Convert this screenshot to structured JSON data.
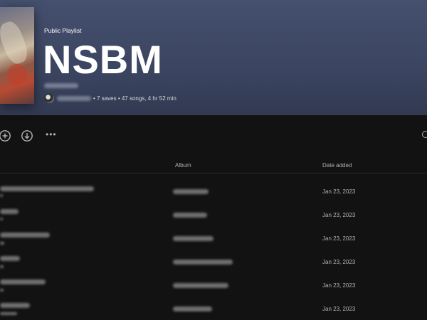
{
  "playlist": {
    "type_label": "Public Playlist",
    "title": "NSBM",
    "meta": "• 7 saves • 47 songs, 4 hr 52 min"
  },
  "table": {
    "headers": {
      "album": "Album",
      "date_added": "Date added"
    },
    "rows": [
      {
        "date_added": "Jan 23, 2023"
      },
      {
        "date_added": "Jan 23, 2023"
      },
      {
        "date_added": "Jan 23, 2023"
      },
      {
        "date_added": "Jan 23, 2023"
      },
      {
        "date_added": "Jan 23, 2023"
      },
      {
        "date_added": "Jan 23, 2023"
      }
    ]
  },
  "icons": {
    "add": "plus-circle-icon",
    "download": "download-circle-icon",
    "more": "more-options-icon"
  },
  "colors": {
    "header_bg": "#3b4561",
    "page_bg": "#121212",
    "muted_text": "#b3b3b3"
  }
}
